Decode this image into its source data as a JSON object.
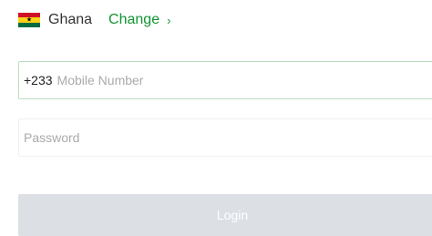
{
  "country": {
    "name": "Ghana",
    "flag_icon": "ghana-flag-icon",
    "flag_colors": [
      "#ce1126",
      "#fcd116",
      "#006b3f"
    ],
    "change_label": "Change",
    "change_icon": "chevron-right-icon",
    "chevron": "›"
  },
  "phone": {
    "prefix": "+233",
    "placeholder": "Mobile Number",
    "value": ""
  },
  "password": {
    "placeholder": "Password",
    "value": ""
  },
  "login": {
    "label": "Login"
  },
  "colors": {
    "accent": "#119433",
    "input_focus_border": "#b9dfc0",
    "button_disabled": "#dcdfe4"
  }
}
